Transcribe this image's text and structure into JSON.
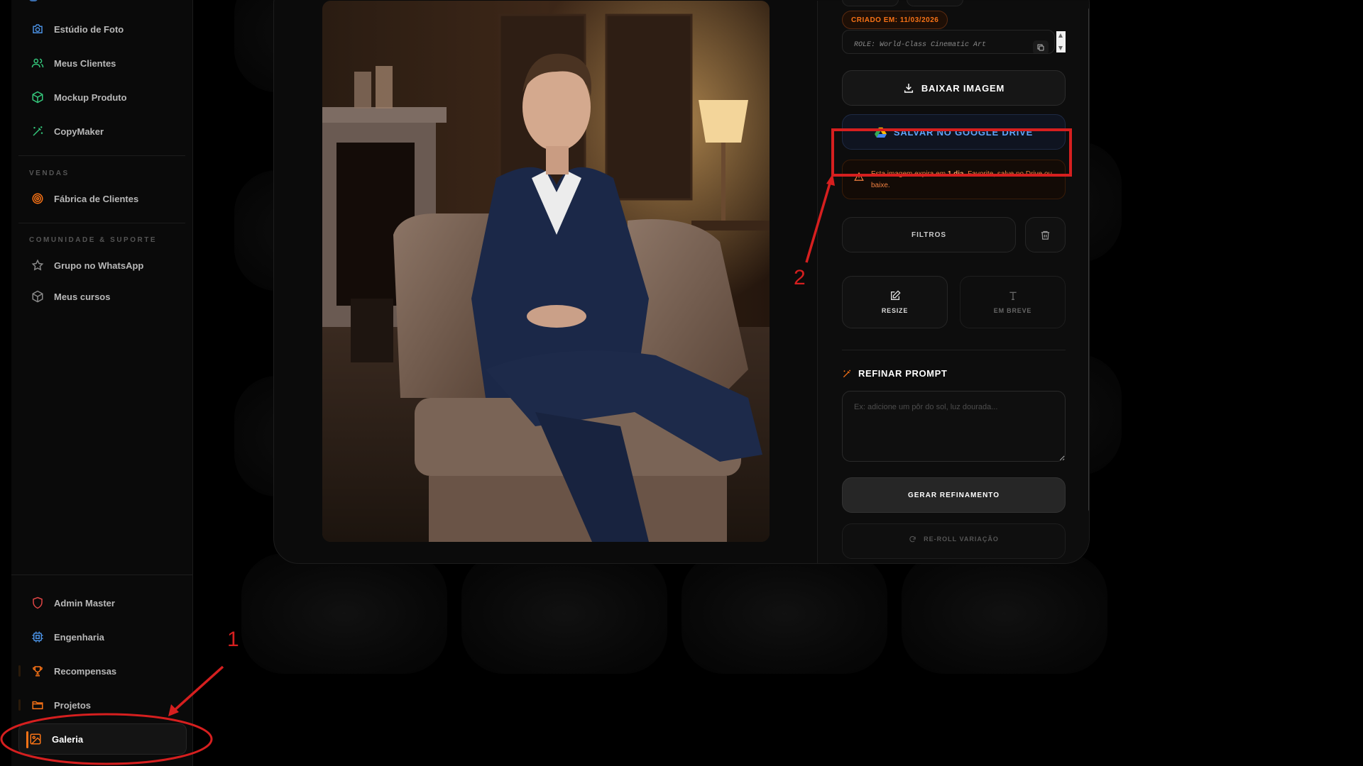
{
  "sidebar": {
    "items_top": [
      {
        "label": "Estúdio de Foto",
        "icon": "camera-icon"
      },
      {
        "label": "Meus Clientes",
        "icon": "users-icon"
      },
      {
        "label": "Mockup Produto",
        "icon": "package-icon"
      },
      {
        "label": "CopyMaker",
        "icon": "magic-wand-icon"
      }
    ],
    "section_sales": "VENDAS",
    "sales_items": [
      {
        "label": "Fábrica de Clientes",
        "icon": "target-icon"
      }
    ],
    "section_community": "COMUNIDADE & SUPORTE",
    "community_items": [
      {
        "label": "Grupo no WhatsApp",
        "icon": "star-icon"
      },
      {
        "label": "Meus cursos",
        "icon": "box-icon"
      }
    ],
    "bottom_items": [
      {
        "label": "Admin Master",
        "icon": "shield-icon"
      },
      {
        "label": "Engenharia",
        "icon": "cpu-icon"
      },
      {
        "label": "Recompensas",
        "icon": "trophy-icon"
      },
      {
        "label": "Projetos",
        "icon": "folder-icon"
      },
      {
        "label": "Galeria",
        "icon": "image-icon",
        "active": true
      }
    ]
  },
  "detail": {
    "created_chip": "CRIADO EM: 11/03/2026",
    "prompt_preview": "ROLE: World-Class Cinematic Art",
    "download_label": "BAIXAR IMAGEM",
    "drive_label": "SALVAR NO GOOGLE DRIVE",
    "warning": {
      "before": "Esta imagem expira em ",
      "bold": "1 dia",
      "after": ". Favorite, salve no Drive ou baixe."
    },
    "filters_label": "FILTROS",
    "resize_label": "RESIZE",
    "soon_label": "EM BREVE",
    "refine_title": "REFINAR PROMPT",
    "refine_placeholder": "Ex: adicione um pôr do sol, luz dourada...",
    "generate_label": "GERAR REFINAMENTO",
    "reroll_label": "RE-ROLL VARIAÇÃO"
  },
  "annotations": {
    "label_1": "1",
    "label_2": "2",
    "color": "#d61f1f"
  },
  "colors": {
    "accent": "#f97316",
    "drive_text": "#60a5fa",
    "background": "#000000"
  }
}
